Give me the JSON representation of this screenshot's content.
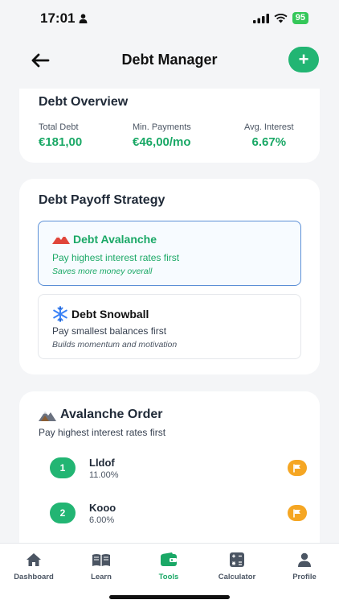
{
  "status": {
    "time": "17:01",
    "battery": "95"
  },
  "header": {
    "title": "Debt Manager",
    "add_label": "+"
  },
  "overview": {
    "title": "Debt Overview",
    "total_label": "Total Debt",
    "total_value": "€181,00",
    "min_label": "Min. Payments",
    "min_value": "€46,00/mo",
    "avg_label": "Avg. Interest",
    "avg_value": "6.67%"
  },
  "strategy": {
    "title": "Debt Payoff Strategy",
    "options": [
      {
        "name": "Debt Avalanche",
        "desc": "Pay highest interest rates first",
        "sub": "Saves more money overall"
      },
      {
        "name": "Debt Snowball",
        "desc": "Pay smallest balances first",
        "sub": "Builds momentum and motivation"
      }
    ]
  },
  "order": {
    "title": "Avalanche Order",
    "subtitle": "Pay highest interest rates first",
    "items": [
      {
        "rank": "1",
        "name": "Lldof",
        "rate": "11.00%"
      },
      {
        "rank": "2",
        "name": "Kooo",
        "rate": "6.00%"
      }
    ]
  },
  "tabs": [
    {
      "label": "Dashboard"
    },
    {
      "label": "Learn"
    },
    {
      "label": "Tools"
    },
    {
      "label": "Calculator"
    },
    {
      "label": "Profile"
    }
  ],
  "colors": {
    "accent": "#22b573",
    "selected_border": "#5b8fd6",
    "flag": "#f5a623"
  }
}
